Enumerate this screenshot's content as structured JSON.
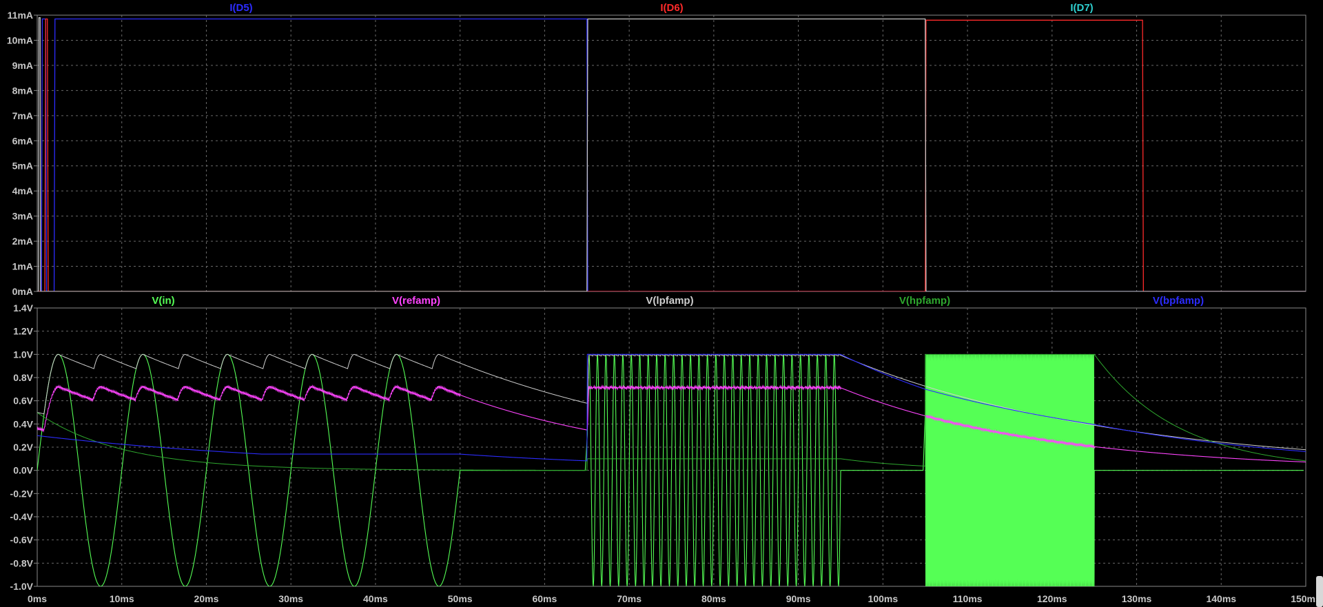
{
  "chart_data": [
    {
      "type": "line",
      "title": "",
      "xlabel": "",
      "ylabel": "",
      "xlim": [
        0,
        150
      ],
      "ylim": [
        0,
        11
      ],
      "x_unit": "ms",
      "y_unit": "mA",
      "grid": true,
      "x_ticks": [
        "0ms",
        "10ms",
        "20ms",
        "30ms",
        "40ms",
        "50ms",
        "60ms",
        "70ms",
        "80ms",
        "90ms",
        "100ms",
        "110ms",
        "120ms",
        "130ms",
        "140ms",
        "150ms"
      ],
      "y_ticks": [
        "0mA",
        "1mA",
        "2mA",
        "3mA",
        "4mA",
        "5mA",
        "6mA",
        "7mA",
        "8mA",
        "9mA",
        "10mA",
        "11mA"
      ],
      "legend": [
        {
          "label": "I(D5)",
          "color": "#2c2cff"
        },
        {
          "label": "I(D6)",
          "color": "#ff2a2a"
        },
        {
          "label": "I(D7)",
          "color": "#2ed0d0"
        }
      ],
      "series": [
        {
          "name": "I(D5)",
          "color": "#2c2cff",
          "points": [
            [
              0,
              0
            ],
            [
              0.5,
              0
            ],
            [
              0.6,
              10.85
            ],
            [
              1.0,
              10.85
            ],
            [
              1.1,
              0
            ],
            [
              2.0,
              0
            ],
            [
              2.1,
              10.85
            ],
            [
              65.0,
              10.85
            ],
            [
              65.1,
              0
            ],
            [
              150,
              0
            ]
          ]
        },
        {
          "name": "I(D6)",
          "color": "#ff2a2a",
          "points": [
            [
              0,
              0
            ],
            [
              0.9,
              0
            ],
            [
              1.0,
              10.85
            ],
            [
              1.2,
              10.85
            ],
            [
              1.3,
              0
            ],
            [
              105.0,
              0
            ],
            [
              105.1,
              10.8
            ],
            [
              130.7,
              10.8
            ],
            [
              130.8,
              0
            ],
            [
              150,
              0
            ]
          ]
        },
        {
          "name": "I(D7)",
          "color": "#c8c8c8",
          "points": [
            [
              0,
              0
            ],
            [
              0.15,
              0
            ],
            [
              0.2,
              10.9
            ],
            [
              0.35,
              10.9
            ],
            [
              0.4,
              0
            ],
            [
              65.0,
              0
            ],
            [
              65.1,
              10.85
            ],
            [
              105.0,
              10.85
            ],
            [
              105.1,
              0
            ],
            [
              150,
              0
            ]
          ]
        }
      ]
    },
    {
      "type": "line",
      "title": "",
      "xlabel": "",
      "ylabel": "",
      "xlim": [
        0,
        150
      ],
      "ylim": [
        -1.0,
        1.4
      ],
      "x_unit": "ms",
      "y_unit": "V",
      "grid": true,
      "x_ticks": [
        "0ms",
        "10ms",
        "20ms",
        "30ms",
        "40ms",
        "50ms",
        "60ms",
        "70ms",
        "80ms",
        "90ms",
        "100ms",
        "110ms",
        "120ms",
        "130ms",
        "140ms",
        "150ms"
      ],
      "y_ticks": [
        "-1.0V",
        "-0.8V",
        "-0.6V",
        "-0.4V",
        "-0.2V",
        "0.0V",
        "0.2V",
        "0.4V",
        "0.6V",
        "0.8V",
        "1.0V",
        "1.2V",
        "1.4V"
      ],
      "legend": [
        {
          "label": "V(in)",
          "color": "#55ff55"
        },
        {
          "label": "V(refamp)",
          "color": "#ff44ff"
        },
        {
          "label": "V(lpfamp)",
          "color": "#cfcfcf"
        },
        {
          "label": "V(hpfamp)",
          "color": "#2ea82e"
        },
        {
          "label": "V(bpfamp)",
          "color": "#2c2cff"
        }
      ],
      "segments": [
        {
          "start": 0,
          "end": 50,
          "frequency_hz": 100,
          "amplitude": 1.0
        },
        {
          "start": 65,
          "end": 95,
          "frequency_hz": 1000,
          "amplitude": 1.0
        },
        {
          "start": 105,
          "end": 125,
          "frequency_hz": 10000,
          "amplitude": 1.0
        }
      ]
    }
  ]
}
